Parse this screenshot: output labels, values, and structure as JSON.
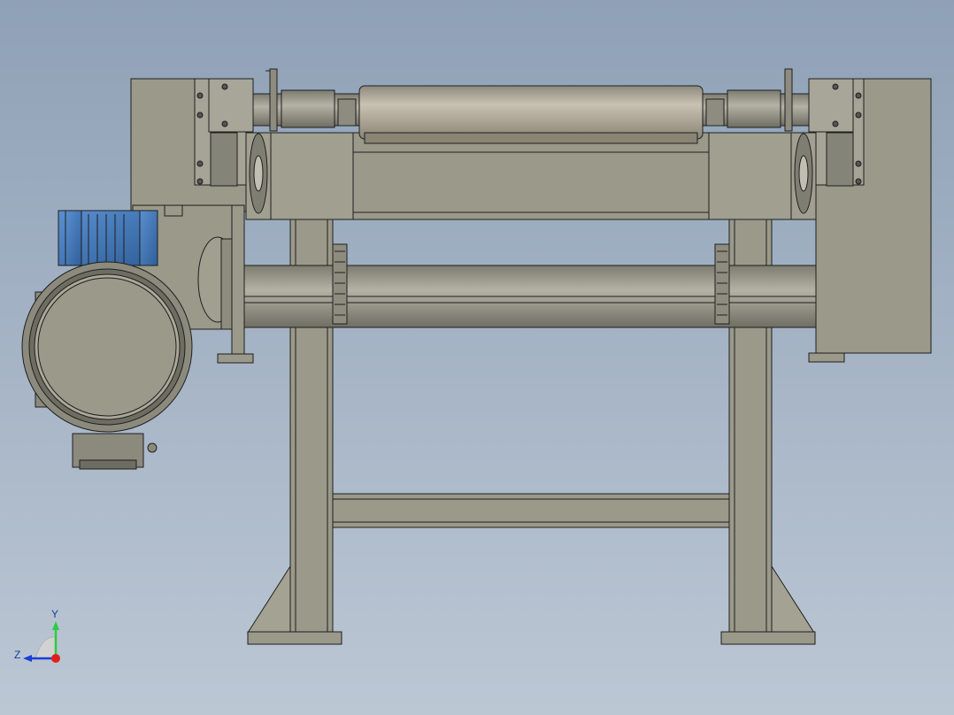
{
  "viewport": {
    "background_top": "#8fa1b7",
    "background_bottom": "#bcc7d4"
  },
  "model": {
    "body_color": "#9a998a",
    "roller_color": "#b9b2a2",
    "motor_color": "#3f78b8",
    "outline_color": "#1f1f1f"
  },
  "triad": {
    "y_label": "Y",
    "z_label": "Z",
    "y_color": "#2ecc40",
    "z_color": "#1a3fd6",
    "x_color": "#e0201c"
  }
}
